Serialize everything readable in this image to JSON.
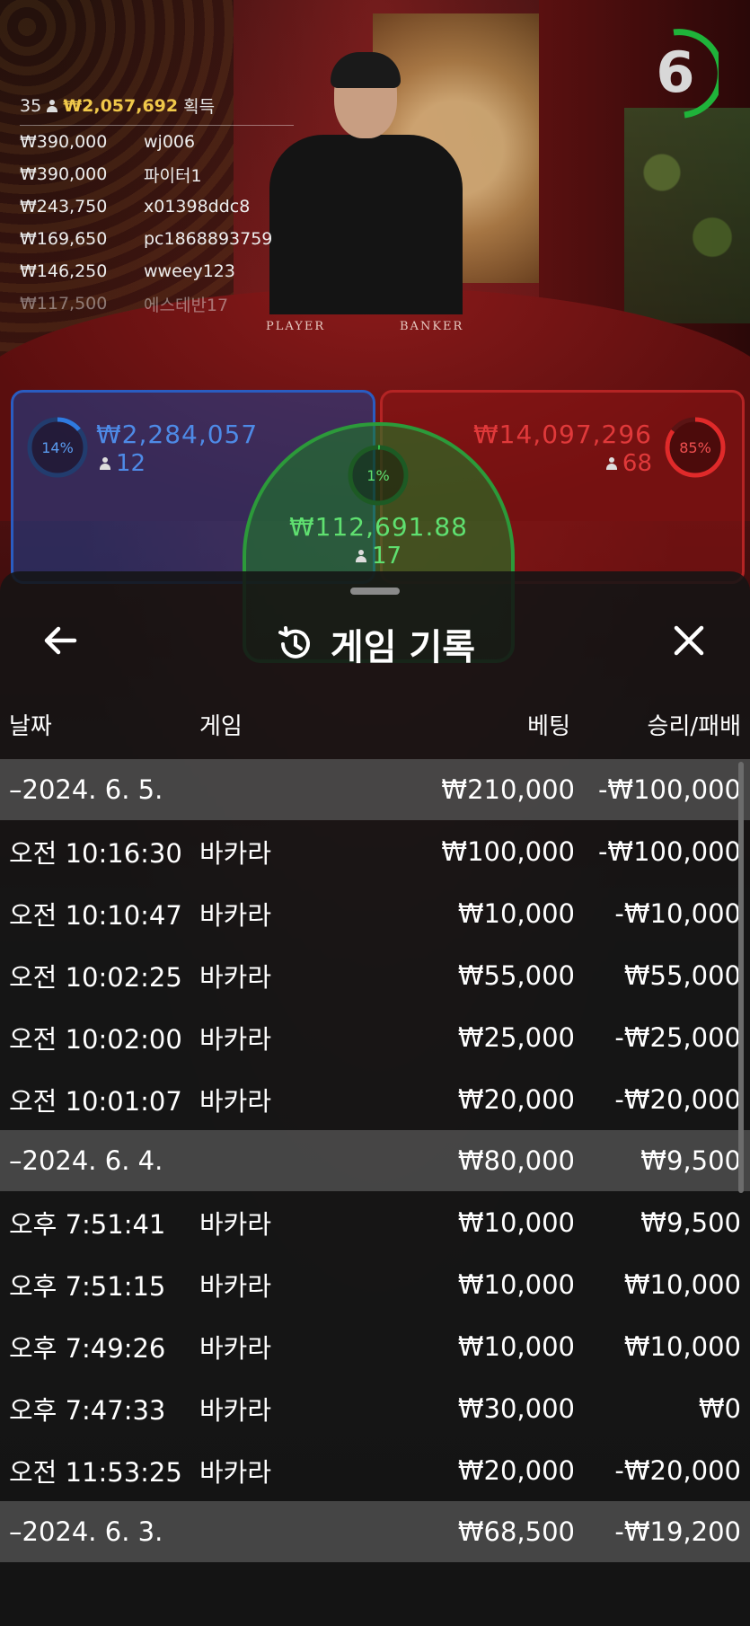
{
  "stream": {
    "table_labels": {
      "player": "PLAYER",
      "banker": "BANKER"
    },
    "timer": "6",
    "leaderboard": {
      "count": "35",
      "total": "₩2,057,692",
      "suffix": "획득",
      "rows": [
        {
          "amount": "₩390,000",
          "user": "wj006"
        },
        {
          "amount": "₩390,000",
          "user": "파이터1"
        },
        {
          "amount": "₩243,750",
          "user": "x01398ddc8"
        },
        {
          "amount": "₩169,650",
          "user": "pc1868893759"
        },
        {
          "amount": "₩146,250",
          "user": "wweey123"
        },
        {
          "amount": "₩117,500",
          "user": "에스테반17"
        }
      ]
    },
    "bets": {
      "player": {
        "pct": "14%",
        "amount": "₩2,284,057",
        "count": "12",
        "pct_value": 14
      },
      "banker": {
        "pct": "85%",
        "amount": "₩14,097,296",
        "count": "68",
        "pct_value": 85
      },
      "tie": {
        "pct": "1%",
        "amount": "₩112,691.88",
        "count": "17",
        "pct_value": 1
      }
    },
    "colors": {
      "player": "#2a5cc0",
      "banker": "#b42424",
      "tie": "#2c9a3a",
      "gold": "#f0c84a"
    }
  },
  "panel": {
    "title": "게임 기록",
    "icons": {
      "back": "arrow-left-icon",
      "history": "history-icon",
      "close": "close-icon"
    },
    "columns": {
      "date": "날짜",
      "game": "게임",
      "bet": "베팅",
      "result": "승리/패배"
    },
    "groups": [
      {
        "date": "–2024. 6. 5.",
        "bet": "₩210,000",
        "result": "-₩100,000",
        "rows": [
          {
            "time": "오전 10:16:30",
            "game": "바카라",
            "bet": "₩100,000",
            "result": "-₩100,000"
          },
          {
            "time": "오전 10:10:47",
            "game": "바카라",
            "bet": "₩10,000",
            "result": "-₩10,000"
          },
          {
            "time": "오전 10:02:25",
            "game": "바카라",
            "bet": "₩55,000",
            "result": "₩55,000"
          },
          {
            "time": "오전 10:02:00",
            "game": "바카라",
            "bet": "₩25,000",
            "result": "-₩25,000"
          },
          {
            "time": "오전 10:01:07",
            "game": "바카라",
            "bet": "₩20,000",
            "result": "-₩20,000"
          }
        ]
      },
      {
        "date": "–2024. 6. 4.",
        "bet": "₩80,000",
        "result": "₩9,500",
        "rows": [
          {
            "time": "오후 7:51:41",
            "game": "바카라",
            "bet": "₩10,000",
            "result": "₩9,500"
          },
          {
            "time": "오후 7:51:15",
            "game": "바카라",
            "bet": "₩10,000",
            "result": "₩10,000"
          },
          {
            "time": "오후 7:49:26",
            "game": "바카라",
            "bet": "₩10,000",
            "result": "₩10,000"
          },
          {
            "time": "오후 7:47:33",
            "game": "바카라",
            "bet": "₩30,000",
            "result": "₩0"
          },
          {
            "time": "오전 11:53:25",
            "game": "바카라",
            "bet": "₩20,000",
            "result": "-₩20,000"
          }
        ]
      },
      {
        "date": "–2024. 6. 3.",
        "bet": "₩68,500",
        "result": "-₩19,200",
        "rows": []
      }
    ]
  }
}
